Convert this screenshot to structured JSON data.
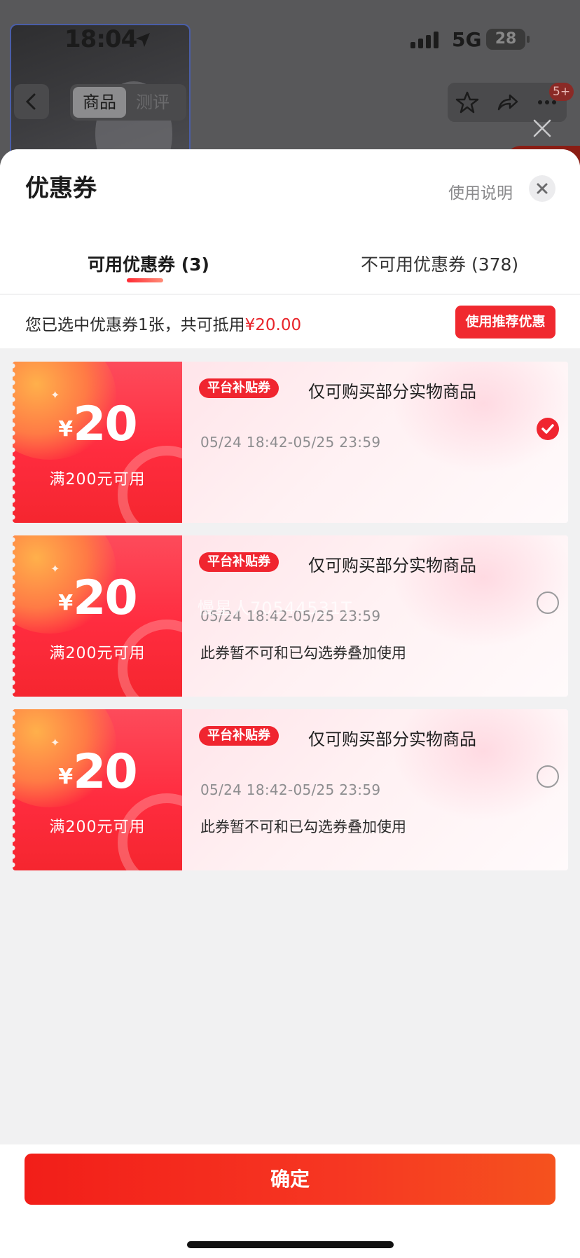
{
  "status_bar": {
    "time": "18:04",
    "network": "5G",
    "battery": "28"
  },
  "background_nav": {
    "tabs": [
      "商品",
      "测评"
    ],
    "message_badge": "5+"
  },
  "sheet": {
    "title": "优惠券",
    "help_link": "使用说明",
    "tabs": [
      {
        "label": "可用优惠券 (3)",
        "active": true
      },
      {
        "label": "不可用优惠券 (378)",
        "active": false
      }
    ],
    "selection": {
      "text": "您已选中优惠券1张，共可抵用",
      "amount": "¥20.00",
      "recommend_button": "使用推荐优惠"
    },
    "coupons": [
      {
        "currency": "¥",
        "value": "20",
        "condition": "满200元可用",
        "tag": "平台补贴券",
        "scope": "仅可购买部分实物商品",
        "validity": "05/24 18:42-05/25 23:59",
        "note": "",
        "selected": true
      },
      {
        "currency": "¥",
        "value": "20",
        "condition": "满200元可用",
        "tag": "平台补贴券",
        "scope": "仅可购买部分实物商品",
        "validity": "05/24 18:42-05/25 23:59",
        "note": "此券暂不可和已勾选券叠加使用",
        "selected": false
      },
      {
        "currency": "¥",
        "value": "20",
        "condition": "满200元可用",
        "tag": "平台补贴券",
        "scope": "仅可购买部分实物商品",
        "validity": "05/24 18:42-05/25 23:59",
        "note": "此券暂不可和已勾选券叠加使用",
        "selected": false
      }
    ],
    "watermark": "慢星人70544531T",
    "confirm_button": "确定"
  },
  "colors": {
    "accent": "#f0252f",
    "confirm_start": "#f21e19",
    "confirm_end": "#f5521e"
  },
  "icons": [
    "location-arrow-icon",
    "signal-bars-icon",
    "back-chevron-icon",
    "star-icon",
    "share-icon",
    "more-dots-icon",
    "close-icon",
    "checkmark-icon"
  ]
}
